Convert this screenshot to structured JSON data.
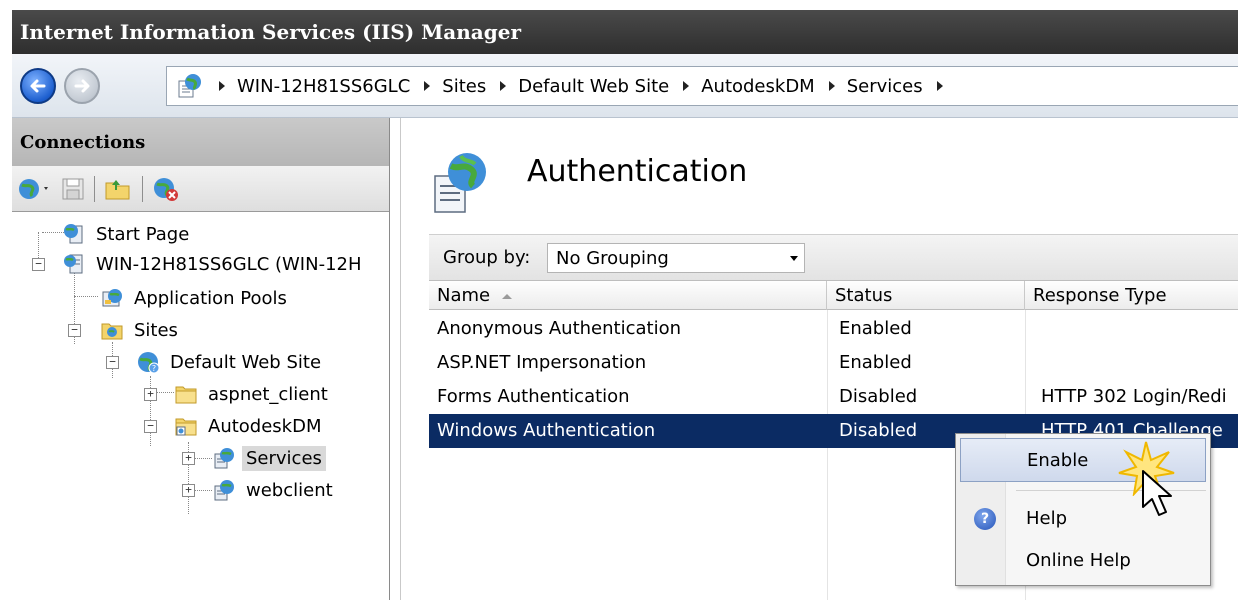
{
  "window": {
    "title": "Internet Information Services (IIS) Manager"
  },
  "nav": {
    "back_icon": "back-arrow-icon",
    "forward_icon": "forward-arrow-icon",
    "breadcrumbs": [
      "WIN-12H81SS6GLC",
      "Sites",
      "Default Web Site",
      "AutodeskDM",
      "Services"
    ]
  },
  "connections": {
    "title": "Connections",
    "toolbar_icons": [
      "globe-connect-icon",
      "save-icon",
      "folder-icon",
      "disconnect-icon"
    ],
    "tree": [
      {
        "label": "Start Page",
        "icon": "start-page-icon"
      },
      {
        "label": "WIN-12H81SS6GLC (WIN-12H",
        "icon": "server-icon"
      },
      {
        "label": "Application Pools",
        "icon": "app-pools-icon"
      },
      {
        "label": "Sites",
        "icon": "sites-folder-icon"
      },
      {
        "label": "Default Web Site",
        "icon": "globe-icon"
      },
      {
        "label": "aspnet_client",
        "icon": "folder-icon"
      },
      {
        "label": "AutodeskDM",
        "icon": "app-folder-icon"
      },
      {
        "label": "Services",
        "icon": "web-app-icon",
        "selected": true
      },
      {
        "label": "webclient",
        "icon": "web-app-icon"
      }
    ]
  },
  "feature": {
    "title": "Authentication",
    "icon": "authentication-icon",
    "group_by_label": "Group by:",
    "group_by_value": "No Grouping",
    "columns": [
      "Name",
      "Status",
      "Response Type"
    ],
    "rows": [
      {
        "name": "Anonymous Authentication",
        "status": "Enabled",
        "response": ""
      },
      {
        "name": "ASP.NET Impersonation",
        "status": "Enabled",
        "response": ""
      },
      {
        "name": "Forms Authentication",
        "status": "Disabled",
        "response": "HTTP 302 Login/Redi"
      },
      {
        "name": "Windows Authentication",
        "status": "Disabled",
        "response": "HTTP 401 Challenge",
        "selected": true
      }
    ]
  },
  "context_menu": {
    "items": [
      "Enable",
      "Help",
      "Online Help"
    ],
    "highlighted": "Enable"
  },
  "colors": {
    "selection": "#0b2b63",
    "titlebar": "#3a3a3a",
    "menu_highlight": "#cfd9ec"
  }
}
